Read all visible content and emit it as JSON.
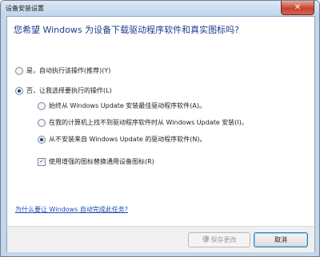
{
  "window": {
    "title": "设备安装设置",
    "close_glyph": "✕"
  },
  "headline": "您希望 Windows 为设备下载驱动程序软件和真实图标吗?",
  "options": {
    "auto": {
      "label": "是，自动执行该操作(推荐)(Y)",
      "selected": false
    },
    "manual": {
      "label": "否，让我选择要执行的操作(L)",
      "selected": true
    },
    "sub": [
      {
        "label": "始终从 Windows Update 安装最佳驱动程序软件(A)。",
        "selected": false
      },
      {
        "label": "在我的计算机上找不到驱动程序软件时从 Windows Update 安装(I)。",
        "selected": false
      },
      {
        "label": "从不安装来自 Windows Update 的驱动程序软件(N)。",
        "selected": true
      }
    ],
    "enhanced_icons": {
      "label": "使用增强的图标替换通用设备图标(R)",
      "checked": true
    }
  },
  "help_link": "为什么要让 Windows 自动完成此任务?",
  "buttons": {
    "save": {
      "label": "保存更改",
      "enabled": false,
      "icon": "uac-shield-icon"
    },
    "cancel": {
      "label": "取消",
      "enabled": true
    }
  },
  "check_glyph": "✓"
}
